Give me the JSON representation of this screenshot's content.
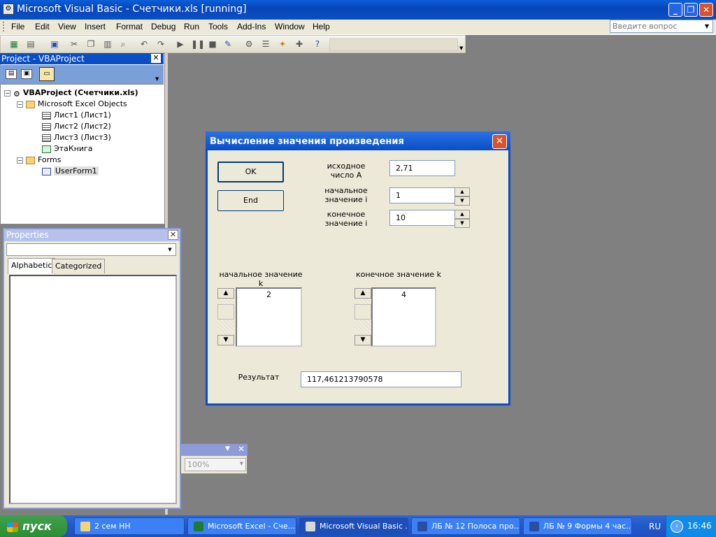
{
  "window": {
    "title": "Microsoft Visual Basic - Счетчики.xls [running]",
    "buttons": {
      "minimize": "_",
      "restore": "❐",
      "close": "✕"
    }
  },
  "menu": {
    "items": [
      "File",
      "Edit",
      "View",
      "Insert",
      "Format",
      "Debug",
      "Run",
      "Tools",
      "Add-Ins",
      "Window",
      "Help"
    ],
    "ask_placeholder": "Введите вопрос"
  },
  "project": {
    "header": "Project - VBAProject",
    "root": "VBAProject (Счетчики.xls)",
    "excel_objects": "Microsoft Excel Objects",
    "sheets": [
      "Лист1 (Лист1)",
      "Лист2 (Лист2)",
      "Лист3 (Лист3)"
    ],
    "workbook": "ЭтаКнига",
    "forms": "Forms",
    "form": "UserForm1"
  },
  "properties": {
    "header": "Properties",
    "tabs": [
      "Alphabetic",
      "Categorized"
    ]
  },
  "zoom": {
    "value": "100%"
  },
  "dialog": {
    "title": "Вычисление значения произведения",
    "ok_label": "OK",
    "end_label": "End",
    "a_label_1": "исходное",
    "a_label_2": "число А",
    "a_value": "2,71",
    "i_start_label_1": "начальное",
    "i_start_label_2": "значение i",
    "i_start_value": "1",
    "i_end_label_1": "конечное",
    "i_end_label_2": "значение i",
    "i_end_value": "10",
    "k_start_label": "начальное значение k",
    "k_start_value": "2",
    "k_end_label": "конечное значение k",
    "k_end_value": "4",
    "result_label": "Результат",
    "result_value": "117,461213790578"
  },
  "taskbar": {
    "start": "пуск",
    "tasks": [
      {
        "label": "2 сем НН",
        "active": false
      },
      {
        "label": "Microsoft Excel - Сче...",
        "active": false
      },
      {
        "label": "Microsoft Visual Basic ...",
        "active": true
      },
      {
        "label": "ЛБ № 12 Полоса про...",
        "active": false
      },
      {
        "label": "ЛБ № 9 Формы 4 час...",
        "active": false
      }
    ],
    "lang": "RU",
    "time": "16:46"
  },
  "colors": {
    "accent": "#0a4ec6",
    "close": "#d9522c",
    "start": "#3ea24a"
  }
}
